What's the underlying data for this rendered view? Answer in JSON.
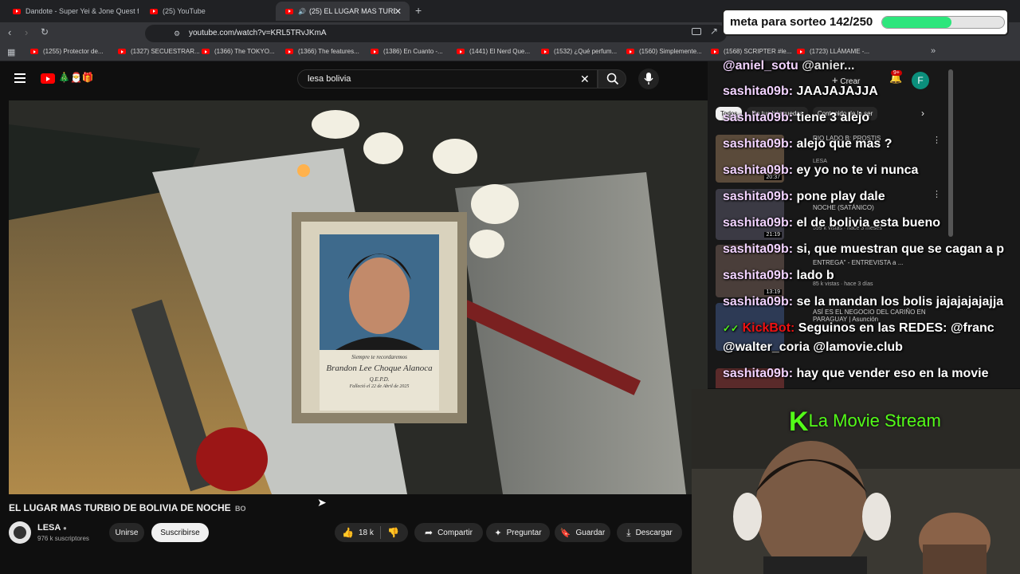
{
  "browser": {
    "tabs": [
      {
        "label": "Dandote - Super Yei & Jone Quest ft"
      },
      {
        "label": "(25) YouTube"
      },
      {
        "label": "(25) EL LUGAR MAS TURBIO D"
      }
    ],
    "url": "youtube.com/watch?v=KRL5TRvJKmA",
    "bookmarks": [
      "(1255) Protector de...",
      "(1327) SECUESTRAR...",
      "(1366) The TOKYO...",
      "(1366) The features...",
      "(1386) En Cuanto -...",
      "(1441) El Nerd Que...",
      "(1532) ¿Qué perfum...",
      "(1560) Simplemente...",
      "(1568) SCRIPTER #le...",
      "(1723) LLÁMAME -..."
    ]
  },
  "youtube": {
    "search_value": "lesa bolivia",
    "create_label": "Crear",
    "notif_badge": "9+",
    "avatar_letter": "F",
    "filter_chips": [
      "Todos",
      "De tus búsquedas",
      "Contenido de la ser"
    ]
  },
  "video": {
    "frame_text": {
      "line1": "Siempre te recordaremos",
      "line2": "Brandon Lee Choque Alanoca",
      "line3": "Q.E.P.D.",
      "line4": "Falleció el 22 de Abril de 2025"
    },
    "title": "EL LUGAR MAS TURBIO DE BOLIVIA DE NOCHE",
    "title_flag": "BO",
    "channel": "LESA",
    "subscribers": "976 k suscriptores",
    "join_label": "Unirse",
    "subscribe_label": "Suscribirse",
    "likes": "18 k",
    "share_label": "Compartir",
    "ask_label": "Preguntar",
    "save_label": "Guardar",
    "download_label": "Descargar"
  },
  "sidebar": {
    "items": [
      {
        "title": "RIO LADO B: PROSTIS",
        "duration": "20:37",
        "meta": "LESA"
      },
      {
        "title": "NOCHE (SATÁNICO)",
        "duration": "21:19",
        "meta": "599 k vistas · hace 3 meses"
      },
      {
        "title": "ENTREGA\" - ENTREVISTA a ...",
        "duration": "13:19",
        "meta": "85 k vistas · hace 3 días"
      },
      {
        "title": "ASÍ ES EL NEGOCIO DEL CARIÑO EN PARAGUAY | Asunción",
        "duration": "",
        "meta": ""
      }
    ]
  },
  "overlay": {
    "sorteo_label": "meta para sorteo 142/250",
    "sorteo_progress": 0.568,
    "stream_title": "La Movie Stream",
    "kick_badge": "KickBot"
  },
  "chat": {
    "messages": [
      {
        "user": "@aniel_sotu",
        "text": "@anier..."
      },
      {
        "user": "sashita09b:",
        "text": "JAAJAJAJJA"
      },
      {
        "user": "sashita09b:",
        "text": "tiene 3 alejo"
      },
      {
        "user": "sashita09b:",
        "text": "alejo que mas ?"
      },
      {
        "user": "sashita09b:",
        "text": "ey yo no te vi nunca"
      },
      {
        "user": "sashita09b:",
        "text": "pone play dale"
      },
      {
        "user": "sashita09b:",
        "text": "el de bolivia esta bueno"
      },
      {
        "user": "sashita09b:",
        "text": "si, que muestran que se cagan a p"
      },
      {
        "user": "sashita09b:",
        "text": "lado b"
      },
      {
        "user": "sashita09b:",
        "text": "se la mandan los bolis jajajajajajja"
      },
      {
        "user": "KickBot:",
        "text": "Seguinos en las REDES: @franc"
      },
      {
        "user": "",
        "text": "@walter_coria @lamovie.club"
      },
      {
        "user": "sashita09b:",
        "text": "hay que vender eso en la movie"
      }
    ]
  }
}
